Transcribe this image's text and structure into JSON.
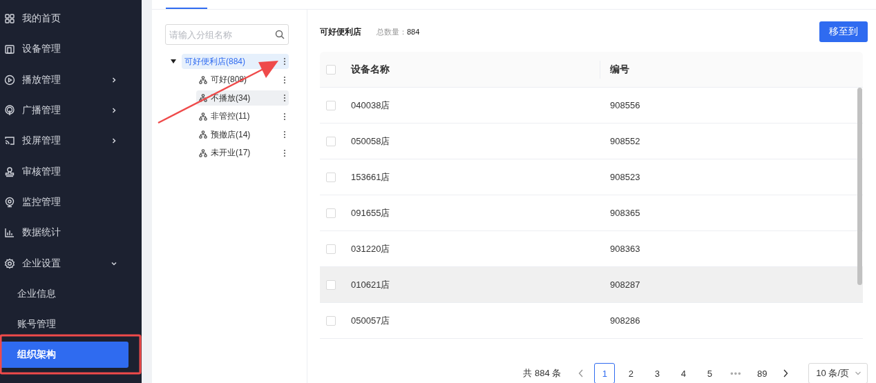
{
  "sidebar": {
    "items": [
      {
        "label": "我的首页",
        "kind": "grid"
      },
      {
        "label": "设备管理",
        "kind": "device"
      },
      {
        "label": "播放管理",
        "kind": "play",
        "expanded": false
      },
      {
        "label": "广播管理",
        "kind": "broadcast",
        "expanded": false
      },
      {
        "label": "投屏管理",
        "kind": "cast",
        "expanded": false
      },
      {
        "label": "审核管理",
        "kind": "stamp"
      },
      {
        "label": "监控管理",
        "kind": "camera"
      },
      {
        "label": "数据统计",
        "kind": "chart"
      },
      {
        "label": "企业设置",
        "kind": "gear",
        "expanded": true,
        "children": [
          {
            "label": "企业信息",
            "selected": false
          },
          {
            "label": "账号管理",
            "selected": false
          },
          {
            "label": "组织架构",
            "selected": true
          }
        ]
      }
    ]
  },
  "tree": {
    "search": {
      "placeholder": "请输入分组名称"
    },
    "root": {
      "label": "可好便利店(884)",
      "selected": true,
      "expanded": true,
      "children": [
        {
          "label": "可好(808)",
          "selected": false,
          "hovered": false
        },
        {
          "label": "不播放(34)",
          "selected": false,
          "hovered": true
        },
        {
          "label": "非管控(11)",
          "selected": false,
          "hovered": false
        },
        {
          "label": "预撤店(14)",
          "selected": false,
          "hovered": false
        },
        {
          "label": "未开业(17)",
          "selected": false,
          "hovered": false
        }
      ]
    }
  },
  "devices": {
    "group_title": "可好便利店",
    "total_label": "总数量：",
    "total": "884",
    "move_button": "移至到",
    "columns": [
      "设备名称",
      "编号"
    ],
    "all_checked": false,
    "rows": [
      {
        "name": "040038店",
        "code": "908556",
        "checked": false,
        "hovered": false
      },
      {
        "name": "050058店",
        "code": "908552",
        "checked": false,
        "hovered": false
      },
      {
        "name": "153661店",
        "code": "908523",
        "checked": false,
        "hovered": false
      },
      {
        "name": "091655店",
        "code": "908365",
        "checked": false,
        "hovered": false
      },
      {
        "name": "031220店",
        "code": "908363",
        "checked": false,
        "hovered": false
      },
      {
        "name": "010621店",
        "code": "908287",
        "checked": false,
        "hovered": true
      },
      {
        "name": "050057店",
        "code": "908286",
        "checked": false,
        "hovered": false
      }
    ]
  },
  "pagination": {
    "total": "共 884 条",
    "pages": [
      {
        "label": "1",
        "selected": true,
        "kind": "page"
      },
      {
        "label": "2",
        "selected": false,
        "kind": "page"
      },
      {
        "label": "3",
        "selected": false,
        "kind": "page"
      },
      {
        "label": "4",
        "selected": false,
        "kind": "page"
      },
      {
        "label": "5",
        "selected": false,
        "kind": "page"
      },
      {
        "label": "•••",
        "kind": "ellipsis"
      },
      {
        "label": "89",
        "selected": false,
        "kind": "page"
      }
    ],
    "page_size": "10 条/页"
  }
}
